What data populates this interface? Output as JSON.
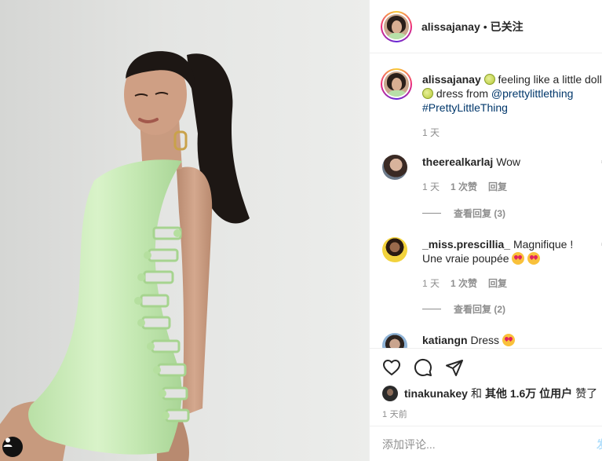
{
  "post": {
    "username": "alissajanay",
    "separator": "•",
    "follow_status": "已关注"
  },
  "caption": {
    "username": "alissajanay",
    "text_part1": "feeling like a little doll",
    "text_part2": "dress from",
    "mention": "@prettylittlething",
    "hashtag": "#PrettyLittleThing",
    "time": "1 天"
  },
  "comments": [
    {
      "username": "theerealkarlaj",
      "text": "Wow",
      "time": "1 天",
      "likes": "1 次赞",
      "reply": "回复",
      "view_replies": "查看回复 (3)"
    },
    {
      "username": "_miss.prescillia_",
      "text": "Magnifique ! Une vraie poupée",
      "time": "1 天",
      "likes": "1 次赞",
      "reply": "回复",
      "view_replies": "查看回复 (2)"
    },
    {
      "username": "katiangn",
      "text": "Dress"
    }
  ],
  "likes": {
    "user": "tinakunakey",
    "conj": "和",
    "others": "其他 1.6万 位用户",
    "suffix": "赞了"
  },
  "post_time": "1 天前",
  "add_comment": {
    "placeholder": "添加评论...",
    "post_label": "发"
  },
  "icons": [
    "heart-icon",
    "comment-icon",
    "share-icon",
    "user-tag-icon"
  ],
  "colors": {
    "link": "#00376b",
    "muted": "#8e8e8e",
    "dress": "#c8eab6"
  }
}
